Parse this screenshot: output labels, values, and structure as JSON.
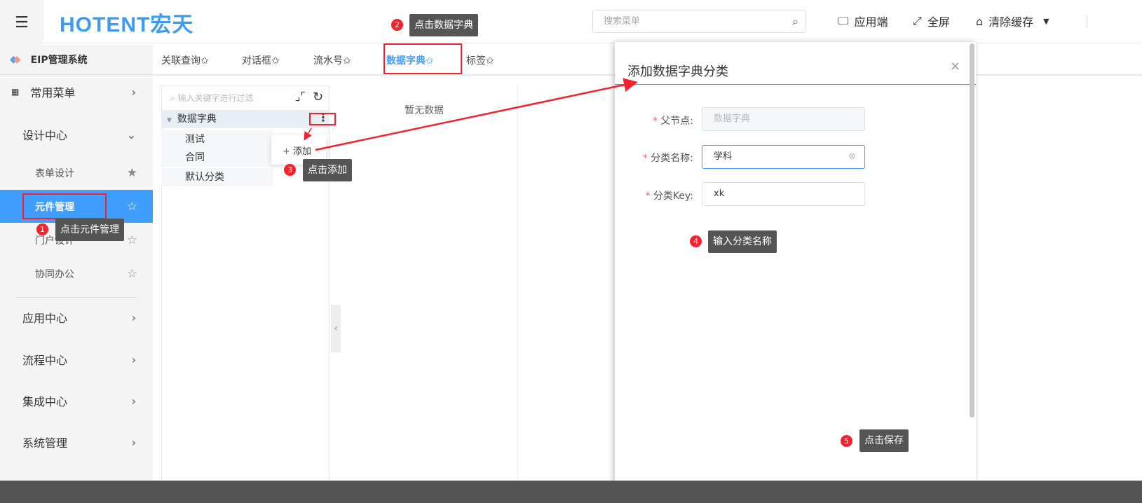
{
  "header": {
    "logo": "HOTENT宏天",
    "search_placeholder": "搜索菜单",
    "app_end": "应用端",
    "fullscreen": "全屏",
    "clear_cache": "清除缓存"
  },
  "sidebar": {
    "system_title": "EIP管理系统",
    "items": [
      {
        "label": "常用菜单"
      },
      {
        "label": "设计中心"
      },
      {
        "label": "表单设计"
      },
      {
        "label": "元件管理"
      },
      {
        "label": "门户设计"
      },
      {
        "label": "协同办公"
      },
      {
        "label": "应用中心"
      },
      {
        "label": "流程中心"
      },
      {
        "label": "集成中心"
      },
      {
        "label": "系统管理"
      }
    ]
  },
  "tabs": [
    {
      "label": "关联查询✩"
    },
    {
      "label": "对话框✩"
    },
    {
      "label": "流水号✩"
    },
    {
      "label": "数据字典✩"
    },
    {
      "label": "标签✩"
    }
  ],
  "tree": {
    "filter_placeholder": "输入关键字进行过滤",
    "root": "数据字典",
    "children": [
      "测试",
      "合同",
      "默认分类"
    ],
    "menu_add": "添加"
  },
  "main": {
    "empty": "暂无数据"
  },
  "dialog": {
    "title": "添加数据字典分类",
    "fields": [
      {
        "label": "父节点:",
        "value": "数据字典"
      },
      {
        "label": "分类名称:",
        "value": "学科"
      },
      {
        "label": "分类Key:",
        "value": "xk"
      }
    ]
  },
  "annotations": [
    {
      "num": "1",
      "text": "点击元件管理"
    },
    {
      "num": "2",
      "text": "点击数据字典"
    },
    {
      "num": "3",
      "text": "点击添加"
    },
    {
      "num": "4",
      "text": "输入分类名称"
    },
    {
      "num": "5",
      "text": "点击保存"
    }
  ]
}
